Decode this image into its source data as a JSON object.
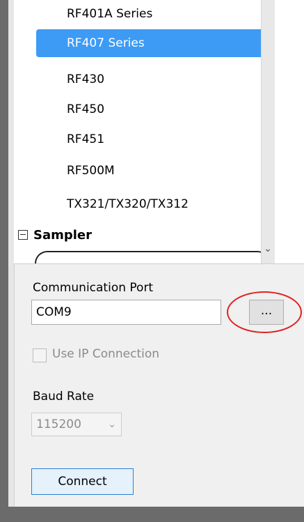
{
  "device_list": {
    "items": [
      {
        "label": "RF401A Series",
        "selected": false
      },
      {
        "label": "RF407 Series",
        "selected": true
      },
      {
        "label": "RF430",
        "selected": false
      },
      {
        "label": "RF450",
        "selected": false
      },
      {
        "label": "RF451",
        "selected": false
      },
      {
        "label": "RF500M",
        "selected": false
      },
      {
        "label": "TX321/TX320/TX312",
        "selected": false
      }
    ],
    "group_header": "Sampler",
    "selection_color": "#3d9bf5"
  },
  "connection": {
    "port_label": "Communication Port",
    "port_value": "COM9",
    "browse_label": "...",
    "use_ip_label": "Use IP Connection",
    "use_ip_checked": false,
    "baud_label": "Baud Rate",
    "baud_value": "115200",
    "connect_label": "Connect"
  },
  "annotation": {
    "highlight_color": "#e02020"
  }
}
